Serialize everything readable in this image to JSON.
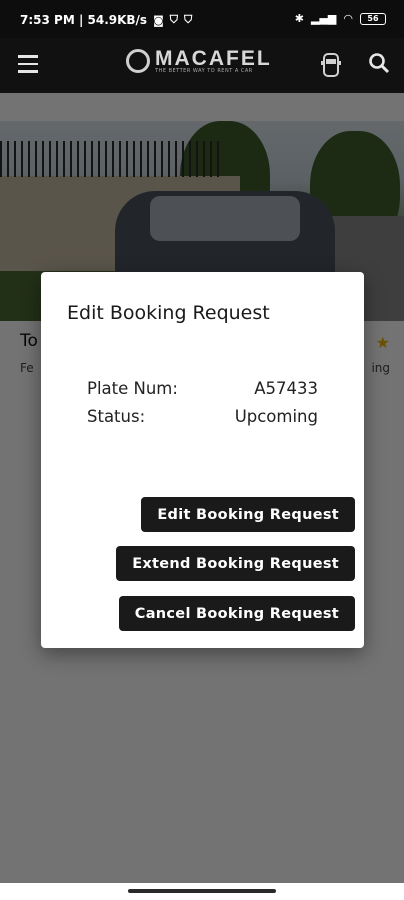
{
  "status_bar": {
    "time_speed": "7:53 PM | 54.9KB/s",
    "battery": "56",
    "icons": [
      "instagram-icon",
      "shield-icon",
      "shield-icon",
      "bluetooth-icon",
      "signal-icon",
      "wifi-icon",
      "battery-icon"
    ]
  },
  "app_bar": {
    "logo_text": "MACAFEL",
    "logo_tagline": "THE BETTER WAY TO RENT A CAR",
    "icons": [
      "menu-icon",
      "car-icon",
      "search-icon"
    ]
  },
  "background_listing": {
    "title": "To",
    "subtitle": "Fe",
    "status": "ing"
  },
  "dialog": {
    "title": "Edit Booking Request",
    "plate_label": "Plate Num:",
    "plate_value": "A57433",
    "status_label": "Status:",
    "status_value": "Upcoming",
    "buttons": {
      "edit": "Edit Booking Request",
      "extend": "Extend Booking Request",
      "cancel": "Cancel Booking Request"
    }
  },
  "colors": {
    "bar_bg": "#111111",
    "button_bg": "#1a1a1a",
    "dialog_bg": "#ffffff",
    "star": "#f0b400"
  }
}
